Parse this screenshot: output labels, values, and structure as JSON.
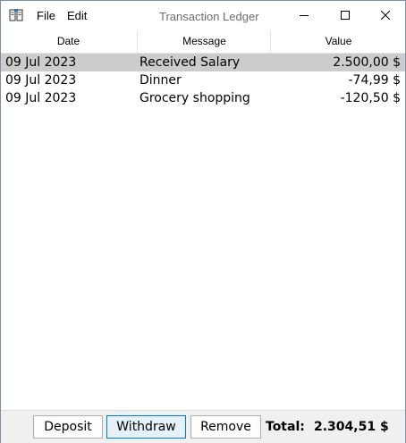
{
  "window": {
    "title": "Transaction Ledger",
    "app_icon": "book-icon"
  },
  "menu": {
    "file": "File",
    "edit": "Edit"
  },
  "table": {
    "columns": [
      "Date",
      "Message",
      "Value"
    ],
    "rows": [
      {
        "date": "09 Jul 2023",
        "message": "Received Salary",
        "value": "2.500,00 $",
        "selected": true
      },
      {
        "date": "09 Jul 2023",
        "message": "Dinner",
        "value": "-74,99 $",
        "selected": false
      },
      {
        "date": "09 Jul 2023",
        "message": "Grocery shopping",
        "value": "-120,50 $",
        "selected": false
      }
    ]
  },
  "footer": {
    "deposit_label": "Deposit",
    "withdraw_label": "Withdraw",
    "remove_label": "Remove",
    "total_label": "Total:",
    "total_value": "2.304,51 $"
  },
  "colors": {
    "selection": "#cccccc",
    "focus_border": "#0078d7",
    "footer_bg": "#f0f0f0"
  }
}
